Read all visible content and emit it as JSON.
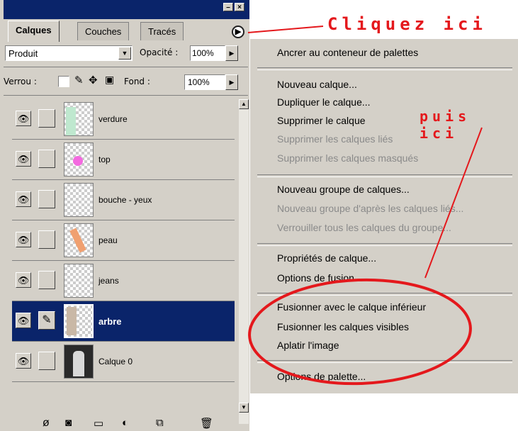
{
  "palette": {
    "tabs": [
      "Calques",
      "Couches",
      "Tracés"
    ],
    "blend_mode": "Produit",
    "opacity_label": "Opacité :",
    "opacity_value": "100%",
    "lock_label": "Verrou :",
    "fill_label": "Fond :",
    "fill_value": "100%",
    "layers": [
      {
        "name": "verdure",
        "selected": false
      },
      {
        "name": "top",
        "selected": false
      },
      {
        "name": "bouche - yeux",
        "selected": false
      },
      {
        "name": "peau",
        "selected": false
      },
      {
        "name": "jeans",
        "selected": false
      },
      {
        "name": "arbre",
        "selected": true
      },
      {
        "name": "Calque 0",
        "selected": false
      }
    ]
  },
  "menu": {
    "items": [
      "Ancrer au conteneur de palettes",
      "Nouveau calque...",
      "Dupliquer le calque...",
      "Supprimer le calque",
      "Supprimer les calques liés",
      "Supprimer les calques masqués",
      "Nouveau groupe de calques...",
      "Nouveau groupe d'après les calques liés...",
      "Verrouiller tous les calques du groupe...",
      "Propriétés de calque...",
      "Options de fusion...",
      "Fusionner avec le calque inférieur",
      "Fusionner les calques visibles",
      "Aplatir l'image",
      "Options de palette..."
    ]
  },
  "annotations": {
    "first": "Cliquez ici",
    "second": "puis ici",
    "color": "#e4181c"
  }
}
